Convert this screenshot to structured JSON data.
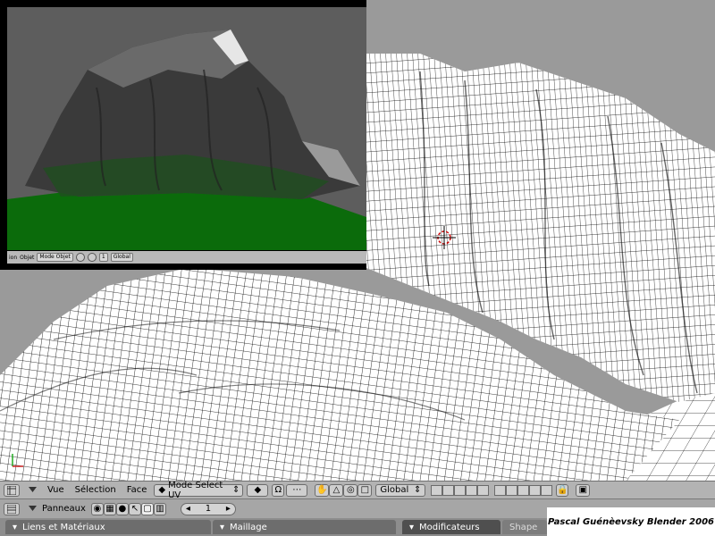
{
  "viewport": {
    "background": "#9a9a9a",
    "wire_color": "#000000",
    "mesh_fill": "#ffffff"
  },
  "inset": {
    "sky": "#5d5d5d",
    "ground": "#0b6b0b",
    "rock": "#3a3a3a",
    "header": {
      "items": [
        "ion",
        "Objet",
        "Mode Objet",
        "1"
      ],
      "mode_label": "Global"
    }
  },
  "header": {
    "menus": [
      "Vue",
      "Sélection",
      "Face"
    ],
    "mode": "Mode Select UV",
    "orientation": "Global",
    "icons": [
      "window-type-icon",
      "menu-toggle-icon",
      "pivot-icon",
      "proportional-icon",
      "hand-icon",
      "rotate-icon",
      "scale-icon",
      "snap-icon",
      "lock-icon",
      "render-icon"
    ]
  },
  "panel_bar": {
    "label": "Panneaux",
    "frame": "1"
  },
  "tabs": {
    "items": [
      "Liens et Matériaux",
      "Maillage",
      "Modificateurs",
      "Shape"
    ]
  },
  "credit": "Pascal Guénèevsky Blender 2006"
}
